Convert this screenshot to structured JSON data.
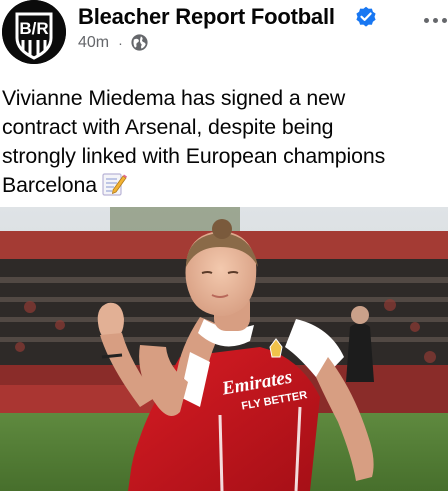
{
  "post": {
    "page_name": "Bleacher Report Football",
    "time": "40m",
    "separator": "·",
    "privacy_icon": "globe-icon",
    "verified_icon": "verified-badge-icon",
    "more_icon": "more-dots-icon",
    "avatar_logo_text": "B/R",
    "text_lines": [
      "Vivianne Miedema has signed a new",
      "contract with Arsenal, despite being",
      "strongly linked with European champions",
      "Barcelona"
    ],
    "text_emoji": "memo-icon",
    "photo": {
      "subject": "footballer-celebrating-photo",
      "shirt_sponsor_line1": "Emirates",
      "shirt_sponsor_line2": "FLY BETTER"
    }
  },
  "colors": {
    "verified_blue": "#1877f2",
    "meta_gray": "#65676b",
    "arsenal_red": "#d0161e"
  }
}
